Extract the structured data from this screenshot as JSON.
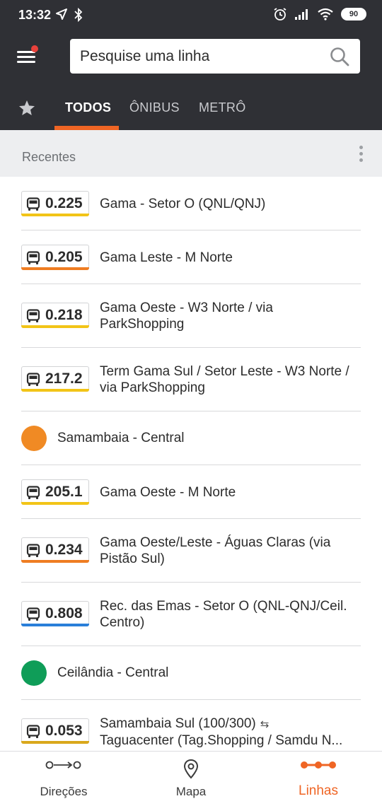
{
  "status_bar": {
    "time": "13:32",
    "battery": "90"
  },
  "search": {
    "placeholder": "Pesquise uma linha"
  },
  "tabs": [
    {
      "label": "TODOS",
      "active": true
    },
    {
      "label": "ÔNIBUS",
      "active": false
    },
    {
      "label": "METRÔ",
      "active": false
    }
  ],
  "section": {
    "title": "Recentes"
  },
  "recent_lines": [
    {
      "kind": "bus",
      "code": "0.225",
      "label": "Gama - Setor O (QNL/QNJ)",
      "stripe_color": "#f2c417"
    },
    {
      "kind": "bus",
      "code": "0.205",
      "label": "Gama Leste - M Norte",
      "stripe_color": "#ef7d22"
    },
    {
      "kind": "bus",
      "code": "0.218",
      "label": "Gama Oeste - W3 Norte / via ParkShopping",
      "stripe_color": "#f2c417"
    },
    {
      "kind": "bus",
      "code": "217.2",
      "label": "Term Gama Sul / Setor Leste - W3 Norte / via ParkShopping",
      "stripe_color": "#f2c417"
    },
    {
      "kind": "metro",
      "label": "Samambaia - Central",
      "dot_color": "#f08a24"
    },
    {
      "kind": "bus",
      "code": "205.1",
      "label": "Gama Oeste - M Norte",
      "stripe_color": "#f2c417"
    },
    {
      "kind": "bus",
      "code": "0.234",
      "label": "Gama Oeste/Leste - Águas Claras (via Pistão Sul)",
      "stripe_color": "#ef7d22"
    },
    {
      "kind": "bus",
      "code": "0.808",
      "label": "Rec. das Emas - Setor O (QNL-QNJ/Ceil. Centro)",
      "stripe_color": "#2a7fd9"
    },
    {
      "kind": "metro",
      "label": "Ceilândia - Central",
      "dot_color": "#0f9d58"
    },
    {
      "kind": "bus",
      "code": "0.053",
      "label": "Samambaia Sul (100/300)",
      "label_cont": "Taguacenter (Tag.Shopping / Samdu N...",
      "stripe_color": "#d9a81c"
    }
  ],
  "bottom_nav": [
    {
      "label": "Direções",
      "icon": "route-icon",
      "active": false
    },
    {
      "label": "Mapa",
      "icon": "map-pin-icon",
      "active": false
    },
    {
      "label": "Linhas",
      "icon": "lines-icon",
      "active": true
    }
  ],
  "colors": {
    "header_bg": "#2f3035",
    "accent": "#ef6524",
    "section_bg": "#edeef0"
  }
}
